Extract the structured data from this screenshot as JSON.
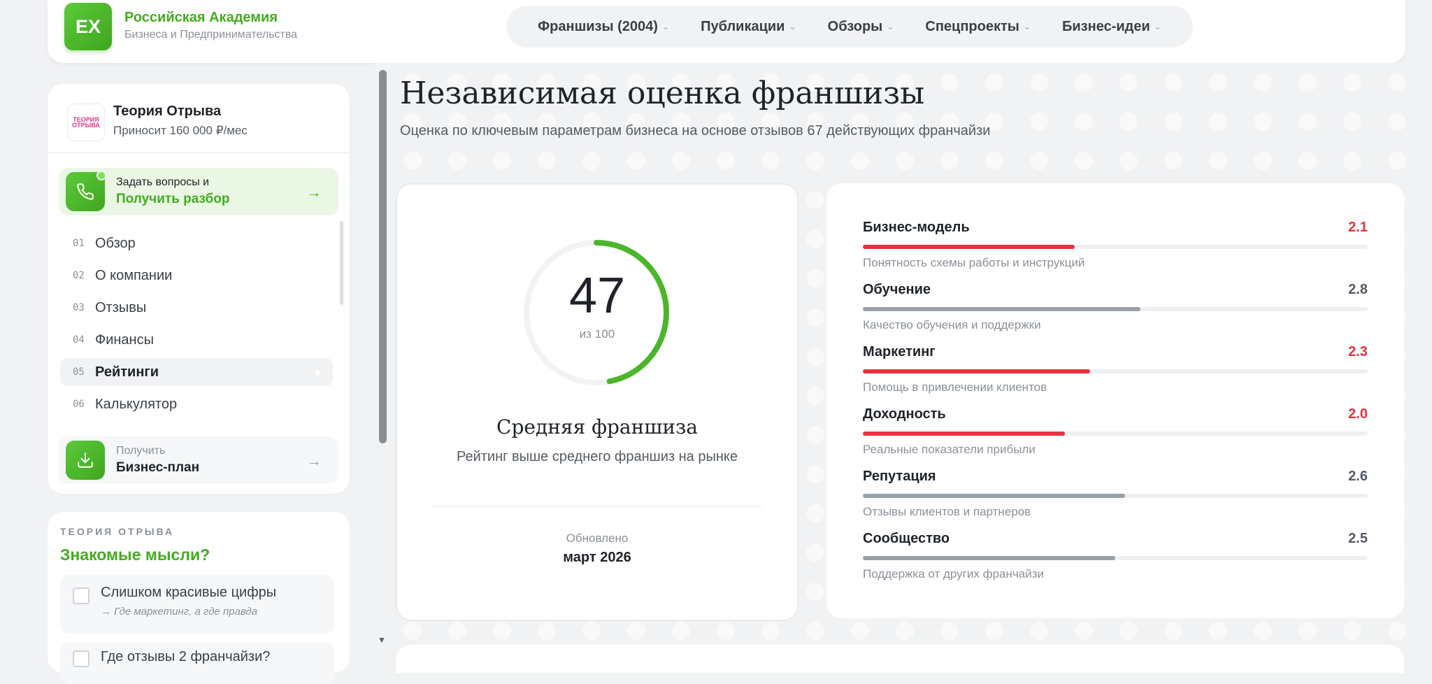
{
  "brand": {
    "logo_text": "EX",
    "name": "Российская Академия",
    "subtitle": "Бизнеса и Предпринимательства"
  },
  "nav": [
    {
      "label": "Франшизы (2004)"
    },
    {
      "label": "Публикации"
    },
    {
      "label": "Обзоры"
    },
    {
      "label": "Спецпроекты"
    },
    {
      "label": "Бизнес-идеи"
    }
  ],
  "franchise": {
    "name": "Теория Отрыва",
    "income": "Приносит 160 000 ₽/мес",
    "logo_text": "ТЕОРИЯ ОТРЫВА"
  },
  "cta_ask": {
    "line1": "Задать вопросы и",
    "line2": "Получить разбор"
  },
  "menu": [
    {
      "num": "01",
      "label": "Обзор"
    },
    {
      "num": "02",
      "label": "О компании"
    },
    {
      "num": "03",
      "label": "Отзывы"
    },
    {
      "num": "04",
      "label": "Финансы"
    },
    {
      "num": "05",
      "label": "Рейтинги",
      "active": true
    },
    {
      "num": "06",
      "label": "Калькулятор"
    }
  ],
  "cta_plan": {
    "line1": "Получить",
    "line2": "Бизнес-план"
  },
  "thoughts": {
    "eyebrow": "ТЕОРИЯ ОТРЫВА",
    "title": "Знакомые мысли?",
    "items": [
      {
        "title": "Слишком красивые цифры",
        "sub": "→ Где маркетинг, а где правда"
      },
      {
        "title": "Где отзывы 2 франчайзи?",
        "sub": ""
      }
    ]
  },
  "page": {
    "title": "Независимая оценка франшизы",
    "subtitle": "Оценка по ключевым параметрам бизнеса на основе отзывов 67 действующих франчайзи"
  },
  "score": {
    "value": "47",
    "value_fraction": 0.47,
    "of": "из 100",
    "title": "Средняя франшиза",
    "description": "Рейтинг выше среднего франшиз на рынке",
    "updated_label": "Обновлено",
    "updated_value": "март 2026",
    "accent": "#4bb62a"
  },
  "params": [
    {
      "name": "Бизнес-модель",
      "value": "2.1",
      "level": 0.42,
      "low": true,
      "desc": "Понятность схемы работы и инструкций"
    },
    {
      "name": "Обучение",
      "value": "2.8",
      "level": 0.55,
      "low": false,
      "desc": "Качество обучения и поддержки"
    },
    {
      "name": "Маркетинг",
      "value": "2.3",
      "level": 0.45,
      "low": true,
      "desc": "Помощь в привлечении клиентов"
    },
    {
      "name": "Доходность",
      "value": "2.0",
      "level": 0.4,
      "low": true,
      "desc": "Реальные показатели прибыли"
    },
    {
      "name": "Репутация",
      "value": "2.6",
      "level": 0.52,
      "low": false,
      "desc": "Отзывы клиентов и партнеров"
    },
    {
      "name": "Сообщество",
      "value": "2.5",
      "level": 0.5,
      "low": false,
      "desc": "Поддержка от других франчайзи"
    }
  ],
  "colors": {
    "brand_green": "#43ad1f",
    "danger_red": "#e8323f",
    "neutral_bar": "#9aa0a8"
  }
}
